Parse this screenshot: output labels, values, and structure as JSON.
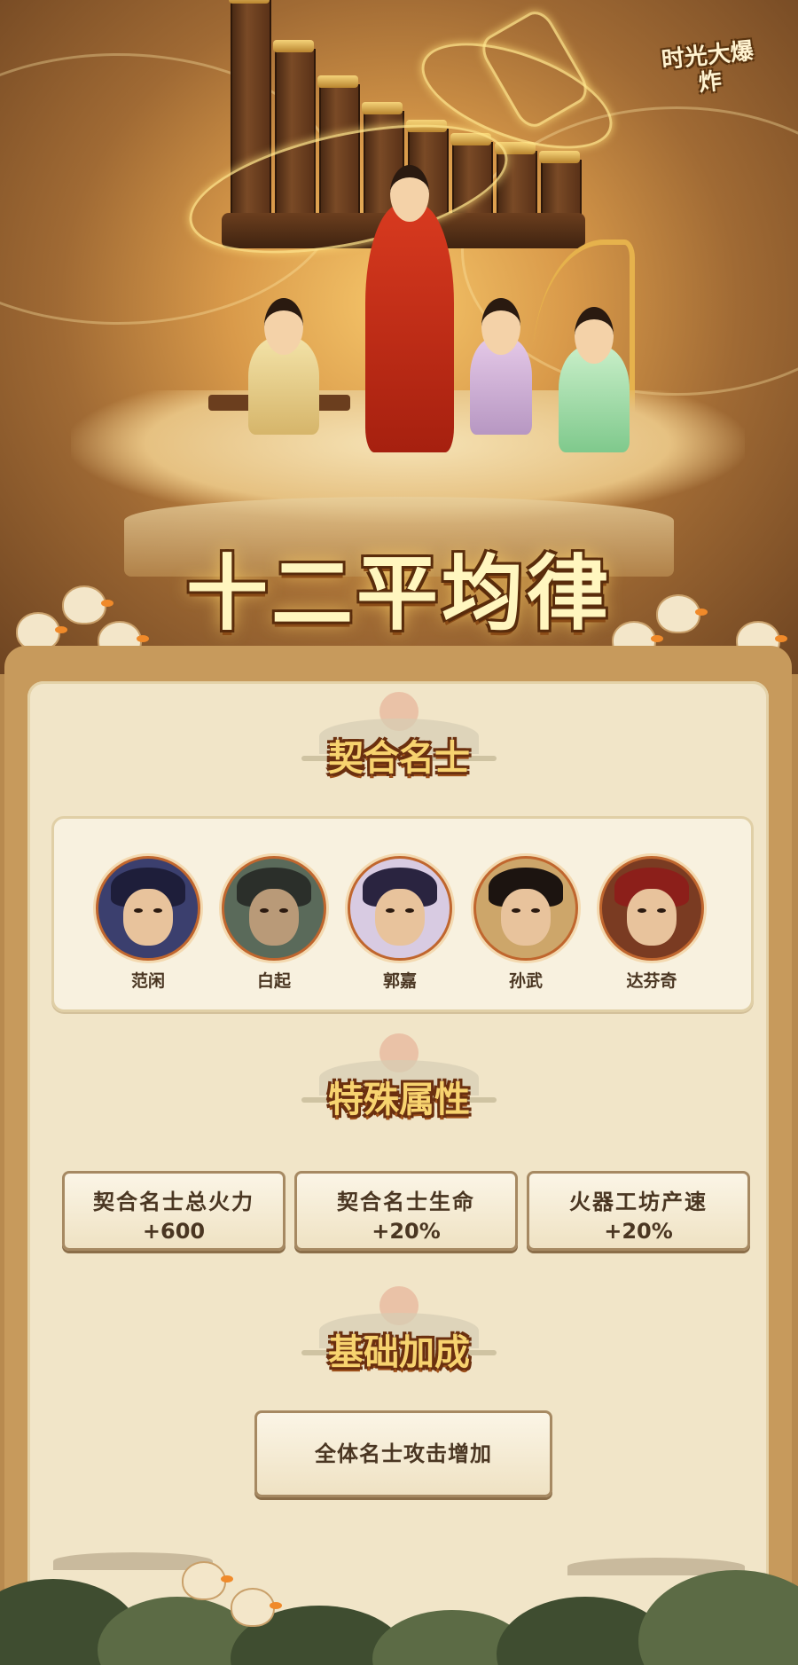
{
  "game": {
    "logo_text": "时光大爆炸"
  },
  "hero_banner": {
    "title": "十二平均律"
  },
  "sections": {
    "heroes_title": "契合名士",
    "attributes_title": "特殊属性",
    "base_title": "基础加成"
  },
  "heroes": [
    {
      "name": "范闲",
      "hair_color": "#1e1e3a",
      "bg": "#3b3f6e"
    },
    {
      "name": "白起",
      "hair_color": "#2b2f2a",
      "bg": "#5a6a5a"
    },
    {
      "name": "郭嘉",
      "hair_color": "#2a2440",
      "bg": "#d8cbe2"
    },
    {
      "name": "孙武",
      "hair_color": "#1c1410",
      "bg": "#cda66a"
    },
    {
      "name": "达芬奇",
      "hair_color": "#8c1f1a",
      "bg": "#7a3b22"
    }
  ],
  "attributes": [
    {
      "label": "契合名士总火力",
      "value": "+600"
    },
    {
      "label": "契合名士生命",
      "value": "+20%"
    },
    {
      "label": "火器工坊产速",
      "value": "+20%"
    }
  ],
  "base_bonus": {
    "label": "全体名士攻击增加"
  },
  "colors": {
    "title_fill": "#f7d36f",
    "title_outline": "#6b3010",
    "panel_bg": "#f1e5c8",
    "button_border": "#a68962",
    "portrait_ring": "#c0662e"
  }
}
